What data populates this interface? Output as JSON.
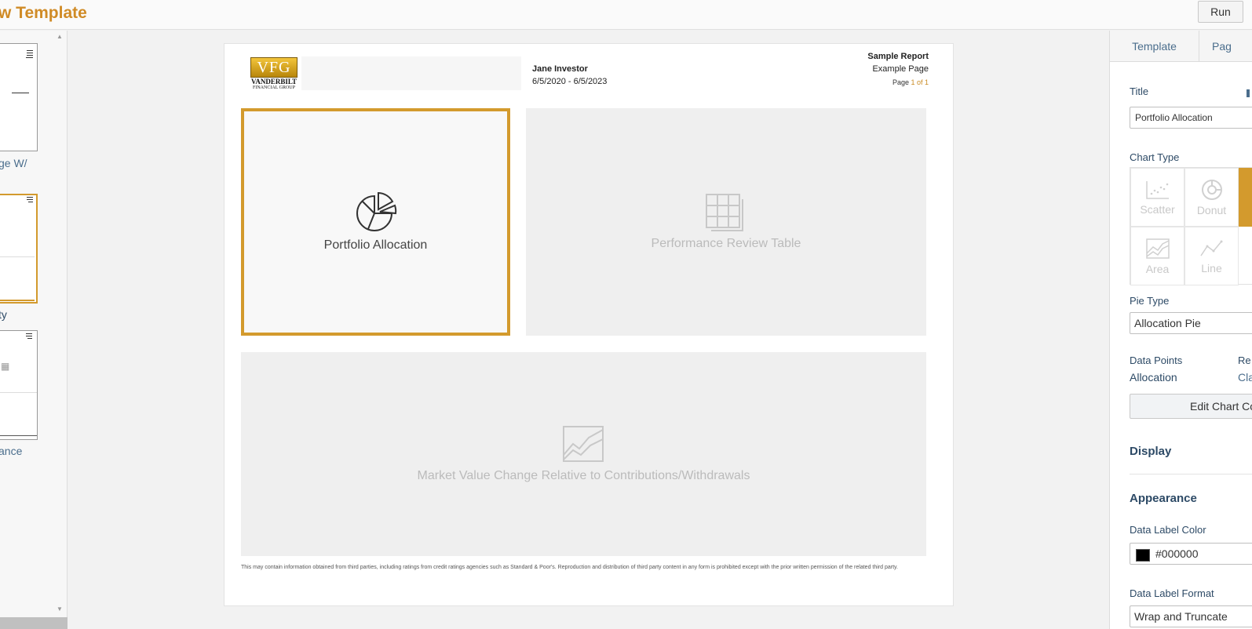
{
  "header": {
    "app_title": "w Template",
    "run_label": "Run"
  },
  "thumbnails": [
    {
      "label": "ge W/"
    },
    {
      "label": "ty"
    },
    {
      "label": "ance"
    }
  ],
  "report": {
    "logo_text": "VFG",
    "logo_line1": "VANDERBILT",
    "logo_line2": "FINANCIAL GROUP",
    "client_name": "Jane Investor",
    "date_range": "6/5/2020 - 6/5/2023",
    "report_name": "Sample Report",
    "page_name": "Example Page",
    "page_prefix": "Page ",
    "page_num": "1 of 1",
    "slots": [
      {
        "label": "Portfolio Allocation",
        "icon": "pie-chart-icon",
        "selected": true
      },
      {
        "label": "Performance Review Table",
        "icon": "table-icon",
        "selected": false
      },
      {
        "label": "Market Value Change Relative to Contributions/Withdrawals",
        "icon": "area-chart-icon",
        "selected": false
      }
    ],
    "disclaimer": "This may contain information obtained from third parties, including ratings from credit ratings agencies such as Standard & Poor's. Reproduction and distribution of third party content in any form is prohibited except with the prior written permission of the related third party."
  },
  "properties": {
    "tabs": [
      "Template",
      "Pag"
    ],
    "title_label": "Title",
    "title_value": "Portfolio Allocation",
    "chart_type_label": "Chart Type",
    "chart_types": [
      {
        "label": "Scatter",
        "icon": "scatter-icon"
      },
      {
        "label": "Donut",
        "icon": "donut-icon"
      },
      {
        "label": "Area",
        "icon": "area-icon"
      },
      {
        "label": "Line",
        "icon": "line-icon"
      }
    ],
    "pie_type_label": "Pie Type",
    "pie_type_value": "Allocation Pie",
    "data_points_label": "Data Points",
    "data_points_value": "Allocation",
    "re_label": "Re",
    "re_value": "Cla",
    "edit_chart_label": "Edit Chart Co",
    "display_label": "Display",
    "appearance_label": "Appearance",
    "data_label_color_label": "Data Label Color",
    "data_label_color_value": "#000000",
    "data_label_format_label": "Data Label Format",
    "data_label_format_value": "Wrap and Truncate",
    "accent_color": "#d39a2d"
  }
}
